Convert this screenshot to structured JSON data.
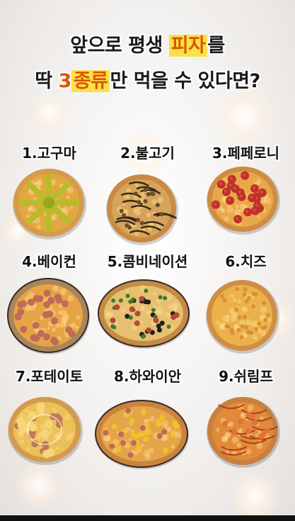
{
  "title": {
    "line1_a": "앞으로 평생 ",
    "line1_highlight": "피자",
    "line1_b": "를",
    "line2_a": "딱 ",
    "line2_num": "3",
    "line2_highlight": "종류",
    "line2_b": "만 먹을 수 있다면?"
  },
  "pizzas": [
    {
      "label": "1.고구마",
      "icon": "sweet-potato-pizza-icon",
      "crust": "#d89a4a",
      "sauce": "#e2a740",
      "topping": "#b7bd2a",
      "kind": "potato"
    },
    {
      "label": "2.불고기",
      "icon": "bulgogi-pizza-icon",
      "crust": "#c98a44",
      "sauce": "#d5a45a",
      "topping": "#3a2818",
      "kind": "bulgogi"
    },
    {
      "label": "3.페페로니",
      "icon": "pepperoni-pizza-icon",
      "crust": "#d08c42",
      "sauce": "#e8a84a",
      "topping": "#c0302a",
      "kind": "pepperoni"
    },
    {
      "label": "4.베이컨",
      "icon": "bacon-pizza-icon",
      "crust": "#a8865c",
      "sauce": "#e6a446",
      "topping": "#c06a58",
      "kind": "bacon"
    },
    {
      "label": "5.콤비네이션",
      "icon": "combination-pizza-icon",
      "crust": "#c48a48",
      "sauce": "#e6c070",
      "topping": "#3d7a2a",
      "kind": "combo"
    },
    {
      "label": "6.치즈",
      "icon": "cheese-pizza-icon",
      "crust": "#d08e44",
      "sauce": "#eab24c",
      "topping": "#f2c868",
      "kind": "cheese"
    },
    {
      "label": "7.포테이토",
      "icon": "potato-pizza-icon",
      "crust": "#d49a4c",
      "sauce": "#ecc058",
      "topping": "#c07a5a",
      "kind": "potatoes"
    },
    {
      "label": "8.하와이안",
      "icon": "hawaiian-pizza-icon",
      "crust": "#c8843e",
      "sauce": "#e4a448",
      "topping": "#f0c030",
      "kind": "hawaiian"
    },
    {
      "label": "9.쉬림프",
      "icon": "shrimp-pizza-icon",
      "crust": "#c8803e",
      "sauce": "#e08a3a",
      "topping": "#b0401c",
      "kind": "shrimp"
    }
  ],
  "colors": {
    "accent": "#e05400",
    "highlight_bg": "#f7e34a",
    "text": "#1a1a1a"
  }
}
